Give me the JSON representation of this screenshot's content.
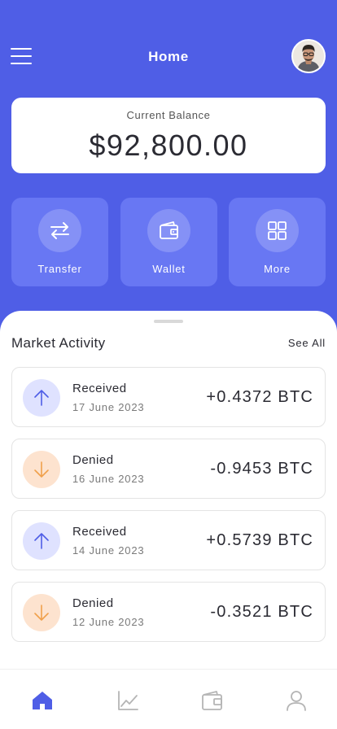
{
  "header": {
    "title": "Home",
    "menu_icon": "hamburger-menu-icon",
    "avatar_icon": "user-avatar"
  },
  "balance": {
    "label": "Current Balance",
    "amount": "$92,800.00"
  },
  "actions": [
    {
      "label": "Transfer",
      "icon": "transfer-arrows-icon"
    },
    {
      "label": "Wallet",
      "icon": "wallet-icon"
    },
    {
      "label": "More",
      "icon": "grid-icon"
    }
  ],
  "market": {
    "title": "Market Activity",
    "see_all": "See All",
    "transactions": [
      {
        "status": "Received",
        "date": "17 June 2023",
        "amount": "+0.4372 BTC",
        "direction": "in"
      },
      {
        "status": "Denied",
        "date": "16 June 2023",
        "amount": "-0.9453 BTC",
        "direction": "out"
      },
      {
        "status": "Received",
        "date": "14 June 2023",
        "amount": "+0.5739 BTC",
        "direction": "in"
      },
      {
        "status": "Denied",
        "date": "12 June 2023",
        "amount": "-0.3521 BTC",
        "direction": "out"
      }
    ]
  },
  "nav": [
    {
      "icon": "home-icon",
      "active": true
    },
    {
      "icon": "chart-icon",
      "active": false
    },
    {
      "icon": "wallet-icon",
      "active": false
    },
    {
      "icon": "profile-icon",
      "active": false
    }
  ],
  "colors": {
    "primary": "#4f5ee6",
    "tile": "#6877f3",
    "received_bg": "#dfe2ff",
    "received_arrow": "#4f5ee6",
    "denied_bg": "#fde3cf",
    "denied_arrow": "#f0a04b",
    "nav_inactive": "#b5b5b5"
  }
}
